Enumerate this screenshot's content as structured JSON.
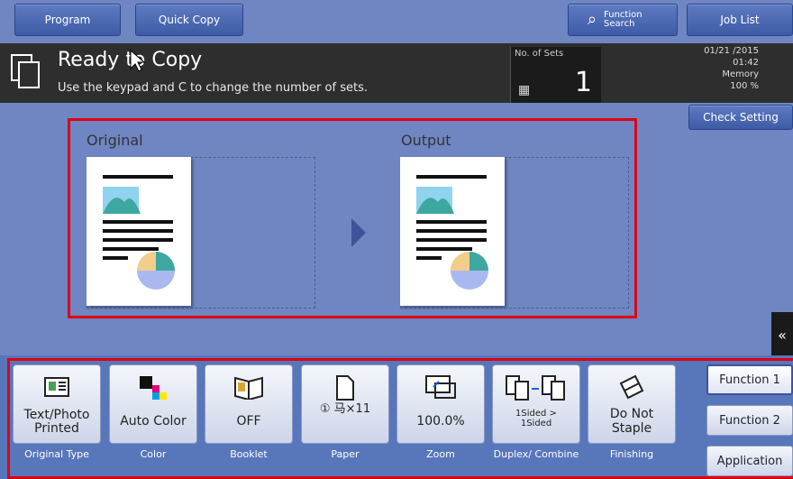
{
  "top": {
    "program": "Program",
    "quick_copy": "Quick Copy",
    "function_search": "Function Search",
    "job_list": "Job List"
  },
  "status": {
    "title": "Ready to Copy",
    "subtitle": "Use the keypad and C to change the number of sets.",
    "sets_label": "No. of Sets",
    "sets_value": "1",
    "date": "01/21 /2015",
    "time": "01:42",
    "memory_label": "Memory",
    "memory_value": "100 %"
  },
  "check_setting": "Check Setting",
  "preview": {
    "original": "Original",
    "output": "Output"
  },
  "functions": [
    {
      "key": "Text/Photo Printed",
      "caption": "Original Type",
      "icon": "original-type-icon"
    },
    {
      "key": "Auto Color",
      "caption": "Color",
      "icon": "color-icon"
    },
    {
      "key": "OFF",
      "caption": "Booklet",
      "icon": "booklet-icon"
    },
    {
      "key": "① 马×11",
      "caption": "Paper",
      "icon": "paper-icon"
    },
    {
      "key": "100.0%",
      "caption": "Zoom",
      "icon": "zoom-icon"
    },
    {
      "key": "1Sided > 1Sided",
      "caption": "Duplex/ Combine",
      "icon": "duplex-icon"
    },
    {
      "key": "Do Not Staple",
      "caption": "Finishing",
      "icon": "finishing-icon"
    }
  ],
  "side": {
    "function1": "Function 1",
    "function2": "Function 2",
    "application": "Application"
  },
  "colors": {
    "red_frame": "#e00012",
    "panel": "#6f86c2"
  }
}
